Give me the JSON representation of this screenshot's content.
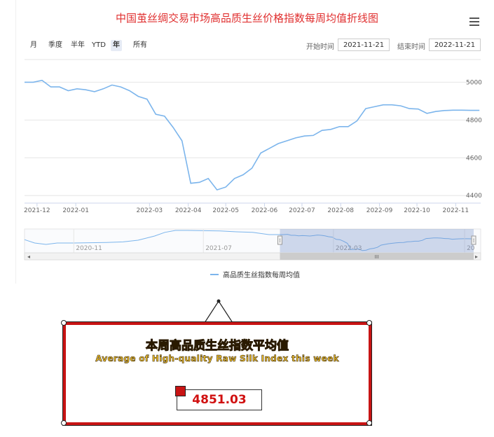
{
  "header": {
    "title": "中国茧丝绸交易市场高品质生丝价格指数每周均值折线图",
    "menu_icon": "hamburger-menu-icon"
  },
  "range_selector": {
    "buttons": [
      {
        "label": "月",
        "active": false
      },
      {
        "label": "季度",
        "active": false
      },
      {
        "label": "半年",
        "active": false
      },
      {
        "label": "YTD",
        "active": false
      },
      {
        "label": "年",
        "active": true
      },
      {
        "label": "所有",
        "active": false
      }
    ],
    "start_label": "开始时间",
    "start_value": "2021-11-21",
    "end_label": "结束时间",
    "end_value": "2022-11-21"
  },
  "chart_data": {
    "type": "line",
    "series": [
      {
        "name": "高品质生丝指数每周均值",
        "color": "#7cb5ec",
        "x": [
          "2021-11-21",
          "2021-11-28",
          "2021-12-05",
          "2021-12-12",
          "2021-12-19",
          "2021-12-26",
          "2022-01-02",
          "2022-01-09",
          "2022-01-16",
          "2022-01-23",
          "2022-01-30",
          "2022-02-06",
          "2022-02-13",
          "2022-02-20",
          "2022-02-27",
          "2022-03-06",
          "2022-03-13",
          "2022-03-20",
          "2022-03-27",
          "2022-04-03",
          "2022-04-10",
          "2022-04-17",
          "2022-04-24",
          "2022-05-01",
          "2022-05-08",
          "2022-05-15",
          "2022-05-22",
          "2022-05-29",
          "2022-06-05",
          "2022-06-12",
          "2022-06-19",
          "2022-06-26",
          "2022-07-03",
          "2022-07-10",
          "2022-07-17",
          "2022-07-24",
          "2022-07-31",
          "2022-08-07",
          "2022-08-14",
          "2022-08-21",
          "2022-08-28",
          "2022-09-04",
          "2022-09-11",
          "2022-09-18",
          "2022-09-25",
          "2022-10-02",
          "2022-10-09",
          "2022-10-16",
          "2022-10-23",
          "2022-10-30",
          "2022-11-06",
          "2022-11-13",
          "2022-11-20"
        ],
        "values": [
          5000,
          5000,
          5010,
          4975,
          4975,
          4955,
          4965,
          4960,
          4950,
          4965,
          4985,
          4975,
          4955,
          4925,
          4910,
          4830,
          4820,
          4760,
          4690,
          4465,
          4470,
          4490,
          4430,
          4445,
          4490,
          4510,
          4545,
          4625,
          4650,
          4675,
          4690,
          4705,
          4715,
          4718,
          4745,
          4750,
          4765,
          4765,
          4795,
          4860,
          4870,
          4880,
          4880,
          4875,
          4860,
          4858,
          4835,
          4845,
          4850,
          4852,
          4852,
          4851,
          4851
        ]
      }
    ],
    "x_ticks": [
      "2021-12",
      "2022-01",
      "2022-03",
      "2022-04",
      "2022-05",
      "2022-06",
      "2022-07",
      "2022-08",
      "2022-09",
      "2022-10",
      "2022-11"
    ],
    "x_tick_dates": [
      "2021-12-01",
      "2022-01-01",
      "2022-03-01",
      "2022-04-01",
      "2022-05-01",
      "2022-06-01",
      "2022-07-01",
      "2022-08-01",
      "2022-09-01",
      "2022-10-01",
      "2022-11-01"
    ],
    "y_ticks": [
      4400,
      4600,
      4800,
      5000
    ],
    "ylim": [
      4360,
      5120
    ],
    "xlim": [
      "2021-11-21",
      "2022-11-21"
    ],
    "grid": true,
    "legend": "bottom-center",
    "navigator": {
      "labels": [
        "2020-11",
        "2021-07",
        "2022-03",
        "20"
      ],
      "label_dates": [
        "2020-11-01",
        "2021-07-01",
        "2022-03-01",
        "2022-11-01"
      ],
      "range": [
        "2020-08-01",
        "2022-12-01"
      ],
      "selected": [
        "2021-11-21",
        "2022-11-21"
      ],
      "scrollbar_glyph": "III",
      "left_arrow": "◂",
      "right_arrow": "▸",
      "handle_glyph": "⁞"
    }
  },
  "callout": {
    "title_cn": "本周高品质生丝指数平均值",
    "title_en": "Average of High-quality Raw Silk Index this week",
    "value": "4851.03",
    "accent_color": "#c81414",
    "text_color": "#f4c430"
  }
}
